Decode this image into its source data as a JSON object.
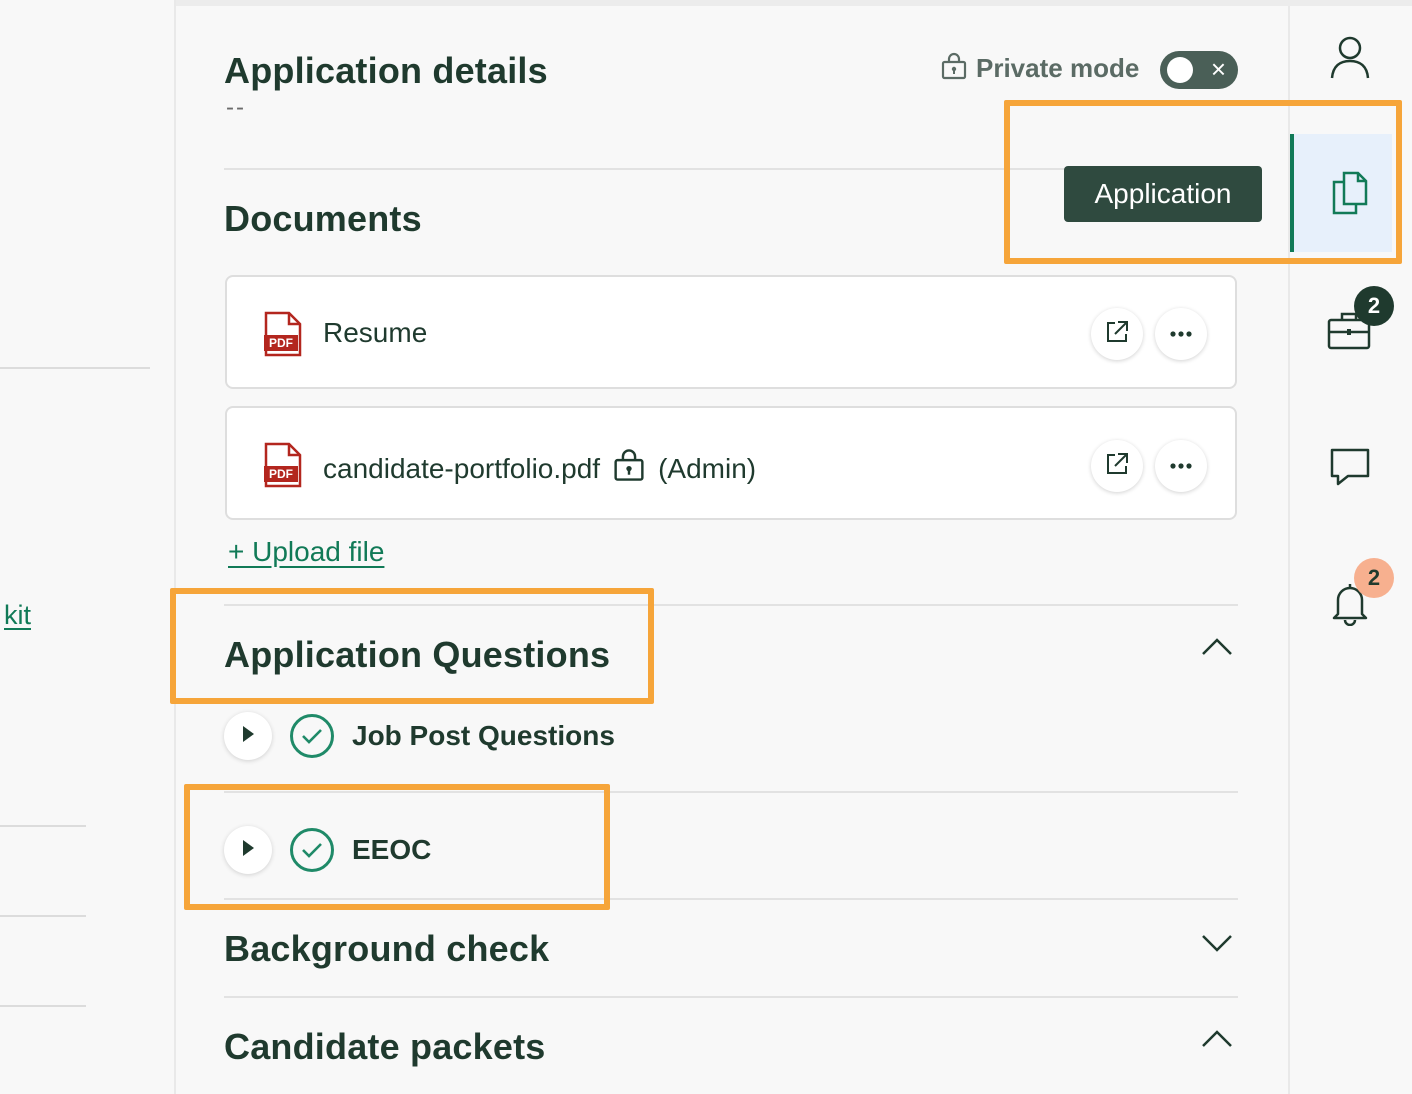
{
  "left_column": {
    "link_fragment": "kit"
  },
  "header": {
    "title": "Application details",
    "subtitle": "--",
    "private_mode": {
      "label": "Private mode",
      "toggle_state": "off",
      "toggle_icon": "close-icon"
    }
  },
  "documents": {
    "title": "Documents",
    "files": [
      {
        "name": "Resume",
        "type_badge": "PDF",
        "suffix": ""
      },
      {
        "name": "candidate-portfolio.pdf",
        "type_badge": "PDF",
        "suffix": "(Admin)"
      }
    ],
    "upload_label": "+ Upload file"
  },
  "application_questions": {
    "title": "Application Questions",
    "expanded": true,
    "items": [
      {
        "label": "Job Post Questions",
        "complete": true
      },
      {
        "label": "EEOC",
        "complete": true
      }
    ]
  },
  "background_check": {
    "title": "Background check",
    "expanded": false
  },
  "candidate_packets": {
    "title": "Candidate packets",
    "expanded": true
  },
  "right_rail": {
    "tooltip": "Application",
    "items": [
      {
        "icon": "person-icon"
      },
      {
        "icon": "documents-icon",
        "active": true
      },
      {
        "icon": "briefcase-icon",
        "badge": "2"
      },
      {
        "icon": "chat-icon"
      },
      {
        "icon": "bell-icon",
        "badge": "2"
      }
    ]
  },
  "colors": {
    "accent": "#117a57",
    "heading": "#1f3a2e",
    "highlight": "#f6a53a",
    "tooltip_bg": "#2f4a3f",
    "badge_dark": "#1f3a2e",
    "badge_peach": "#f7b08f"
  }
}
